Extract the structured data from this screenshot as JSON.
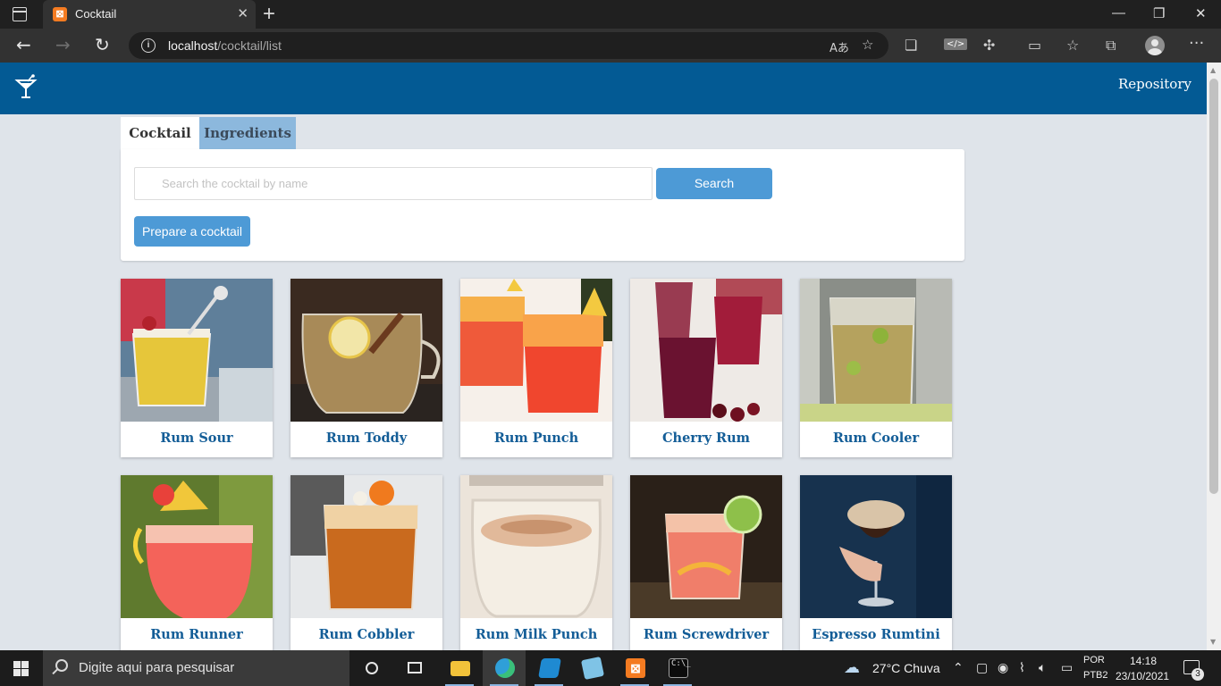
{
  "browser": {
    "tab_title": "Cocktail",
    "tab_close": "✕",
    "new_tab": "+",
    "window_minimize": "—",
    "window_restore": "❐",
    "window_close": "✕",
    "url_host": "localhost",
    "url_path": "/cocktail/list"
  },
  "header": {
    "repository_label": "Repository"
  },
  "tabs": {
    "cocktail": "Cocktail",
    "ingredients": "Ingredients"
  },
  "search": {
    "placeholder": "Search the cocktail by name",
    "button": "Search",
    "prepare_button": "Prepare a cocktail"
  },
  "cocktails": [
    {
      "name": "Rum Sour"
    },
    {
      "name": "Rum Toddy"
    },
    {
      "name": "Rum Punch"
    },
    {
      "name": "Cherry Rum"
    },
    {
      "name": "Rum Cooler"
    },
    {
      "name": "Rum Runner"
    },
    {
      "name": "Rum Cobbler"
    },
    {
      "name": "Rum Milk Punch"
    },
    {
      "name": "Rum Screwdriver"
    },
    {
      "name": "Espresso Rumtini"
    }
  ],
  "taskbar": {
    "search_placeholder": "Digite aqui para pesquisar",
    "weather": "27°C  Chuva",
    "lang_1": "POR",
    "lang_2": "PTB2",
    "time": "14:18",
    "date": "23/10/2021",
    "notifications": "3"
  }
}
